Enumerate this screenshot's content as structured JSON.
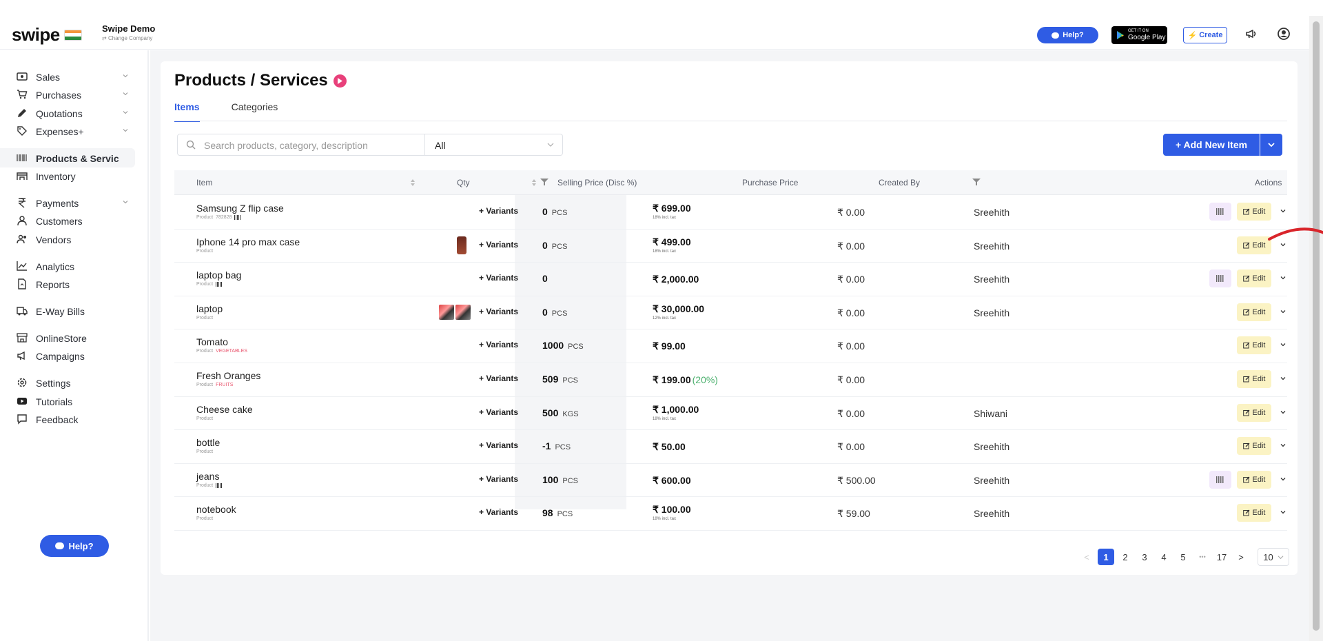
{
  "brand": {
    "logo_text": "swipe",
    "company_name": "Swipe Demo",
    "change_company": "Change Company"
  },
  "topbar": {
    "help_label": "Help?",
    "gplay_small": "GET IT ON",
    "gplay_big": "Google Play",
    "create_label": "Create"
  },
  "sidebar": {
    "items": [
      {
        "label": "Sales",
        "icon": "cash-icon",
        "chevron": true
      },
      {
        "label": "Purchases",
        "icon": "cart-icon",
        "chevron": true
      },
      {
        "label": "Quotations",
        "icon": "pen-icon",
        "chevron": true
      },
      {
        "label": "Expenses+",
        "icon": "tag-icon",
        "chevron": true
      },
      {
        "label": "Products & Servic",
        "icon": "barcode-icon",
        "chevron": false,
        "active": true
      },
      {
        "label": "Inventory",
        "icon": "warehouse-icon",
        "chevron": false
      },
      {
        "label": "Payments",
        "icon": "rupee-icon",
        "chevron": true
      },
      {
        "label": "Customers",
        "icon": "user-icon",
        "chevron": false
      },
      {
        "label": "Vendors",
        "icon": "users-icon",
        "chevron": false
      },
      {
        "label": "Analytics",
        "icon": "chart-icon",
        "chevron": false
      },
      {
        "label": "Reports",
        "icon": "report-icon",
        "chevron": false
      },
      {
        "label": "E-Way Bills",
        "icon": "truck-icon",
        "chevron": false
      },
      {
        "label": "OnlineStore",
        "icon": "store-icon",
        "chevron": false
      },
      {
        "label": "Campaigns",
        "icon": "megaphone-icon",
        "chevron": false
      },
      {
        "label": "Settings",
        "icon": "gear-icon",
        "chevron": false
      },
      {
        "label": "Tutorials",
        "icon": "youtube-icon",
        "chevron": false
      },
      {
        "label": "Feedback",
        "icon": "chat-icon",
        "chevron": false
      }
    ],
    "help_label": "Help?"
  },
  "page": {
    "title": "Products / Services",
    "tabs": [
      {
        "label": "Items",
        "active": true
      },
      {
        "label": "Categories",
        "active": false
      }
    ],
    "search_placeholder": "Search products, category, description",
    "filter_value": "All",
    "add_label": "+ Add New Item"
  },
  "table": {
    "headers": {
      "item": "Item",
      "qty": "Qty",
      "selling": "Selling Price (Disc %)",
      "purchase": "Purchase Price",
      "created": "Created By",
      "actions": "Actions"
    },
    "variants_label": "+ Variants",
    "edit_label": "Edit",
    "rows": [
      {
        "name": "Samsung Z flip case",
        "sub": "Product",
        "code": "782828",
        "code_red": false,
        "barcode_tag": true,
        "thumb": "",
        "variants": "+ Variants",
        "qty": "0",
        "unit": "PCS",
        "price": "₹ 699.00",
        "disc": "",
        "tax": "18% incl. tax",
        "purchase": "₹ 0.00",
        "creator": "Sreehith",
        "barcode_btn": true
      },
      {
        "name": "Iphone 14 pro max case",
        "sub": "Product",
        "code": "",
        "code_red": false,
        "barcode_tag": false,
        "thumb": "phone",
        "variants": "+ Variants",
        "qty": "0",
        "unit": "PCS",
        "price": "₹ 499.00",
        "disc": "",
        "tax": "18% incl. tax",
        "purchase": "₹ 0.00",
        "creator": "Sreehith",
        "barcode_btn": false
      },
      {
        "name": "laptop bag",
        "sub": "Product",
        "code": "",
        "code_red": false,
        "barcode_tag": true,
        "thumb": "",
        "variants": "+ Variants",
        "qty": "0",
        "unit": "",
        "price": "₹ 2,000.00",
        "disc": "",
        "tax": "",
        "purchase": "₹ 0.00",
        "creator": "Sreehith",
        "barcode_btn": true
      },
      {
        "name": "laptop",
        "sub": "Product",
        "code": "",
        "code_red": false,
        "barcode_tag": false,
        "thumb": "laptop",
        "variants": "+ Variants",
        "qty": "0",
        "unit": "PCS",
        "price": "₹ 30,000.00",
        "disc": "",
        "tax": "12% incl. tax",
        "purchase": "₹ 0.00",
        "creator": "Sreehith",
        "barcode_btn": false
      },
      {
        "name": "Tomato",
        "sub": "Product",
        "code": "VEGETABLES",
        "code_red": true,
        "barcode_tag": false,
        "thumb": "",
        "variants": "+ Variants",
        "qty": "1000",
        "unit": "PCS",
        "price": "₹ 99.00",
        "disc": "",
        "tax": "",
        "purchase": "₹ 0.00",
        "creator": "",
        "barcode_btn": false
      },
      {
        "name": "Fresh Oranges",
        "sub": "Product",
        "code": "FRUITS",
        "code_red": true,
        "barcode_tag": false,
        "thumb": "",
        "variants": "+ Variants",
        "qty": "509",
        "unit": "PCS",
        "price": "₹ 199.00",
        "disc": "(20%)",
        "tax": "",
        "purchase": "₹ 0.00",
        "creator": "",
        "barcode_btn": false
      },
      {
        "name": "Cheese cake",
        "sub": "Product",
        "code": "",
        "code_red": false,
        "barcode_tag": false,
        "thumb": "",
        "variants": "+ Variants",
        "qty": "500",
        "unit": "KGS",
        "price": "₹ 1,000.00",
        "disc": "",
        "tax": "18% incl. tax",
        "purchase": "₹ 0.00",
        "creator": "Shiwani",
        "barcode_btn": false
      },
      {
        "name": "bottle",
        "sub": "Product",
        "code": "",
        "code_red": false,
        "barcode_tag": false,
        "thumb": "",
        "variants": "+ Variants",
        "qty": "-1",
        "unit": "PCS",
        "price": "₹ 50.00",
        "disc": "",
        "tax": "",
        "purchase": "₹ 0.00",
        "creator": "Sreehith",
        "barcode_btn": false
      },
      {
        "name": "jeans",
        "sub": "Product",
        "code": "",
        "code_red": false,
        "barcode_tag": true,
        "thumb": "",
        "variants": "+ Variants",
        "qty": "100",
        "unit": "PCS",
        "price": "₹ 600.00",
        "disc": "",
        "tax": "",
        "purchase": "₹ 500.00",
        "creator": "Sreehith",
        "barcode_btn": true
      },
      {
        "name": "notebook",
        "sub": "Product",
        "code": "",
        "code_red": false,
        "barcode_tag": false,
        "thumb": "",
        "variants": "+ Variants",
        "qty": "98",
        "unit": "PCS",
        "price": "₹ 100.00",
        "disc": "",
        "tax": "18% incl. tax",
        "purchase": "₹ 59.00",
        "creator": "Sreehith",
        "barcode_btn": false
      }
    ]
  },
  "pagination": {
    "pages": [
      "1",
      "2",
      "3",
      "4",
      "5"
    ],
    "ellipsis": "•••",
    "last": "17",
    "current": "1",
    "page_size": "10"
  },
  "colors": {
    "primary": "#2f5ce4",
    "accent_pink": "#e8407a",
    "edit_bg": "#fbf3c4",
    "barcode_bg": "#f2e9fb",
    "discount_green": "#4cb06e",
    "annotation_red": "#d9252b"
  }
}
